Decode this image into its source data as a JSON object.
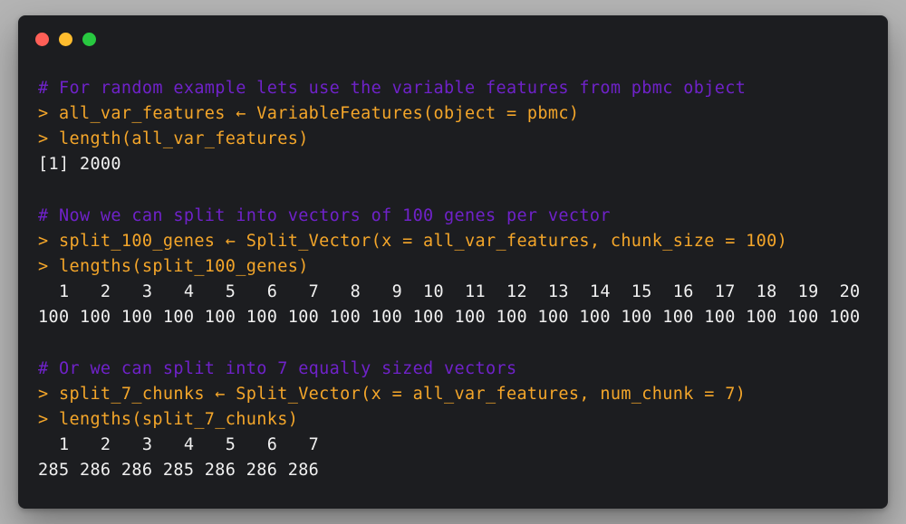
{
  "window": {
    "controls": {
      "close_color": "#ff5f57",
      "minimize_color": "#febc2e",
      "zoom_color": "#28c840"
    }
  },
  "colors": {
    "background": "#1c1d20",
    "comment": "#6f22c9",
    "prompt": "#f4a62a",
    "output": "#f0f0f0"
  },
  "code": {
    "lines": [
      {
        "type": "comment",
        "text": "# For random example lets use the variable features from pbmc object"
      },
      {
        "type": "prompt",
        "text": "> all_var_features ← VariableFeatures(object = pbmc)"
      },
      {
        "type": "prompt",
        "text": "> length(all_var_features)"
      },
      {
        "type": "output",
        "text": "[1] 2000"
      },
      {
        "type": "blank",
        "text": ""
      },
      {
        "type": "comment",
        "text": "# Now we can split into vectors of 100 genes per vector"
      },
      {
        "type": "prompt",
        "text": "> split_100_genes ← Split_Vector(x = all_var_features, chunk_size = 100)"
      },
      {
        "type": "prompt",
        "text": "> lengths(split_100_genes)"
      },
      {
        "type": "output",
        "text": "  1   2   3   4   5   6   7   8   9  10  11  12  13  14  15  16  17  18  19  20"
      },
      {
        "type": "output",
        "text": "100 100 100 100 100 100 100 100 100 100 100 100 100 100 100 100 100 100 100 100"
      },
      {
        "type": "blank",
        "text": ""
      },
      {
        "type": "comment",
        "text": "# Or we can split into 7 equally sized vectors"
      },
      {
        "type": "prompt",
        "text": "> split_7_chunks ← Split_Vector(x = all_var_features, num_chunk = 7)"
      },
      {
        "type": "prompt",
        "text": "> lengths(split_7_chunks)"
      },
      {
        "type": "output",
        "text": "  1   2   3   4   5   6   7"
      },
      {
        "type": "output",
        "text": "285 286 286 285 286 286 286"
      }
    ]
  }
}
